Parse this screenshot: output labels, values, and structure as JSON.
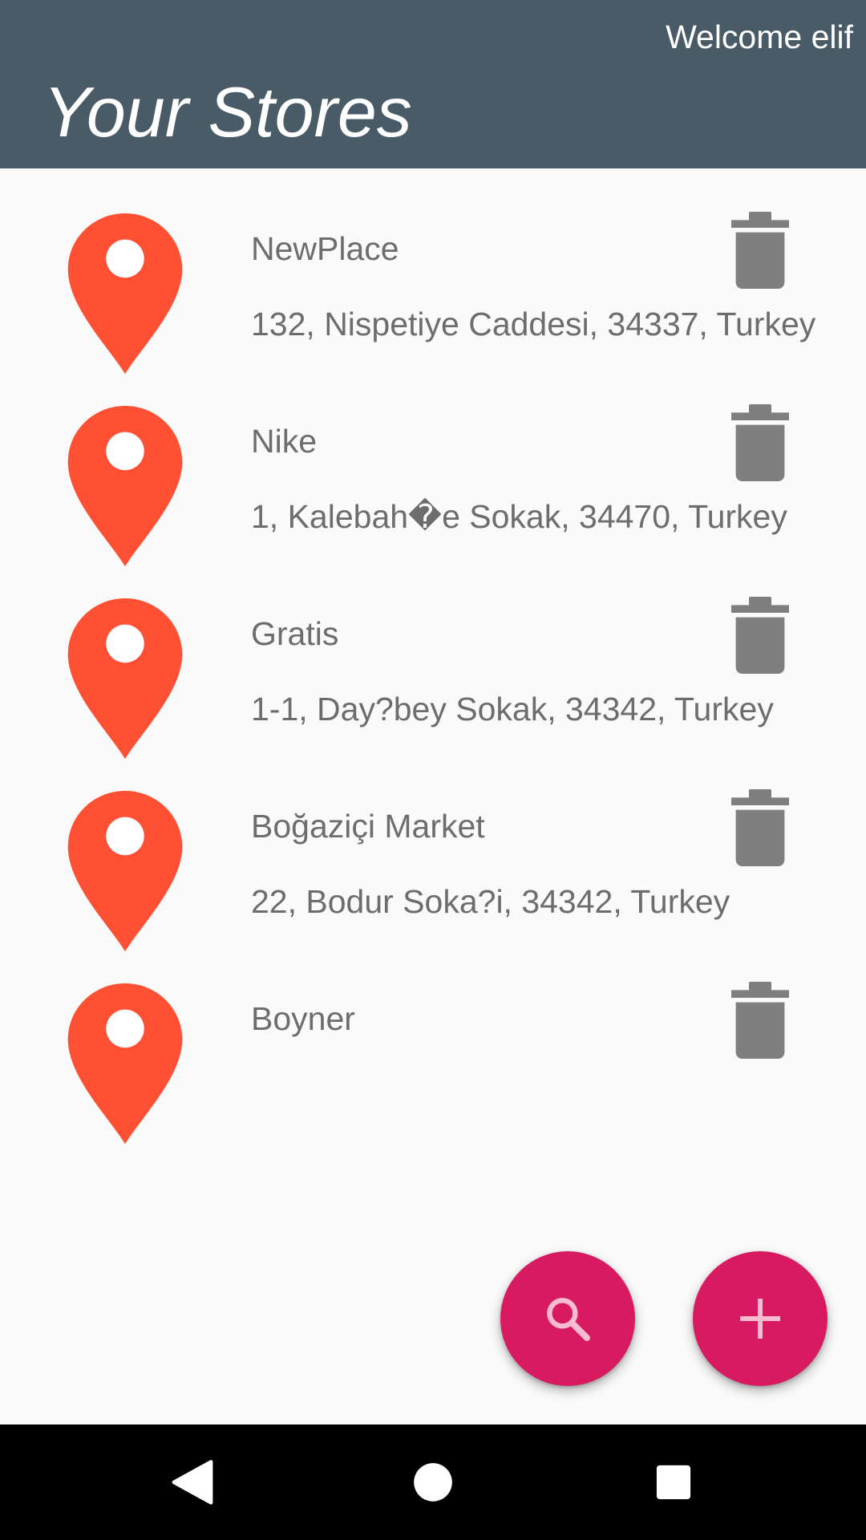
{
  "header": {
    "welcome_text": "Welcome elif",
    "title": "Your Stores",
    "background_color": "#485b67"
  },
  "stores": [
    {
      "name": "NewPlace",
      "address": "132, Nispetiye Caddesi, 34337, Turkey"
    },
    {
      "name": "Nike",
      "address": "1, Kalebah�e Sokak, 34470, Turkey"
    },
    {
      "name": "Gratis",
      "address": "1-1, Day?bey Sokak, 34342, Turkey"
    },
    {
      "name": "Boğaziçi Market",
      "address": "22, Bodur Soka?i, 34342, Turkey"
    },
    {
      "name": "Boyner",
      "address": ""
    }
  ],
  "icons": {
    "store_pin": "map-pin-icon",
    "delete": "trash-icon",
    "search": "search-icon",
    "add": "plus-icon",
    "nav_back": "back-triangle-icon",
    "nav_home": "home-circle-icon",
    "nav_recents": "recents-square-icon"
  },
  "colors": {
    "pin": "#ff5034",
    "trash": "#7f7f7f",
    "fab": "#d81b60",
    "fab_icon": "#f8bbd0",
    "text": "#6d6d6d"
  }
}
